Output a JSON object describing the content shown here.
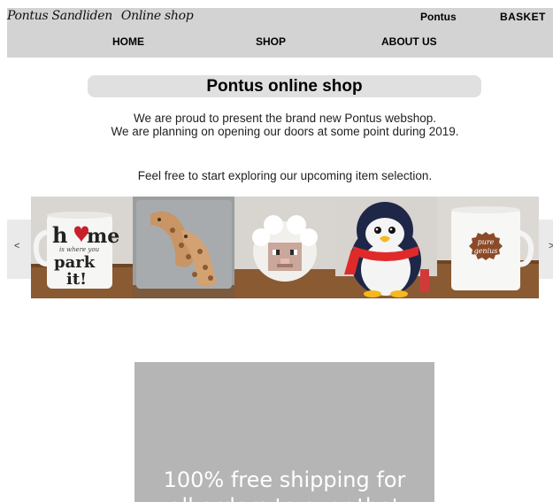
{
  "header": {
    "logo_name": "Pontus Sandliden",
    "logo_tag": "Online shop",
    "user_link": "Pontus",
    "basket_link": "BASKET",
    "nav": {
      "home": "HOME",
      "shop": "SHOP",
      "about": "ABOUT US"
    }
  },
  "main": {
    "title": "Pontus online shop",
    "intro_line1": "We are proud to present the brand new Pontus webshop.",
    "intro_line2": "We are planning on opening our doors at some point during 2019.",
    "explore": "Feel free to start exploring our upcoming item selection."
  },
  "carousel": {
    "prev": "<",
    "next": ">",
    "mug1": {
      "word1": "h",
      "word1b": "me",
      "small": "is where you",
      "word2": "park",
      "word3": "it!"
    },
    "mug2": {
      "line1": "pure",
      "line2": "genius"
    }
  },
  "promo": {
    "line1": "100% free shipping for",
    "line2": "all orders to over that"
  },
  "colors": {
    "header_bg": "#d3d3d3",
    "title_bg": "#e0e0e0",
    "promo_bg": "#b5b5b5"
  },
  "icons": [
    "heart-icon"
  ]
}
